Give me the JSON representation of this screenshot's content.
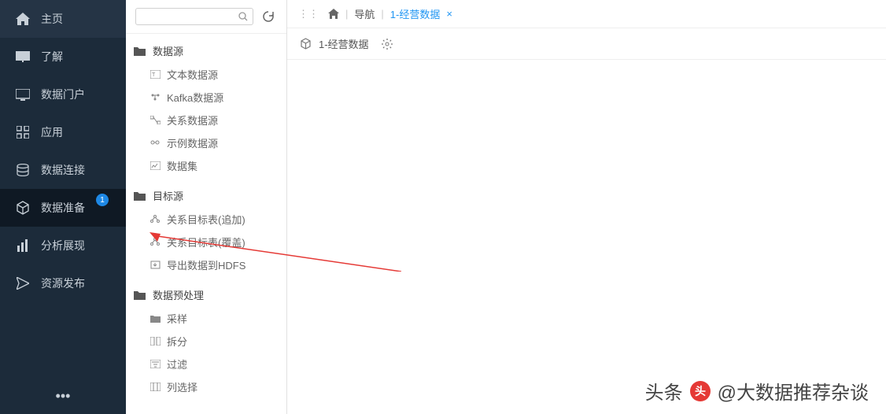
{
  "sidebar": {
    "items": [
      {
        "label": "主页",
        "icon": "home"
      },
      {
        "label": "了解",
        "icon": "book"
      },
      {
        "label": "数据门户",
        "icon": "monitor"
      },
      {
        "label": "应用",
        "icon": "apps"
      },
      {
        "label": "数据连接",
        "icon": "database"
      },
      {
        "label": "数据准备",
        "icon": "cube",
        "badge": "1",
        "active": true
      },
      {
        "label": "分析展现",
        "icon": "chart"
      },
      {
        "label": "资源发布",
        "icon": "send"
      }
    ],
    "more": "•••"
  },
  "search": {
    "placeholder": ""
  },
  "tree": {
    "folders": [
      {
        "label": "数据源",
        "items": [
          {
            "label": "文本数据源",
            "icon": "text"
          },
          {
            "label": "Kafka数据源",
            "icon": "kafka"
          },
          {
            "label": "关系数据源",
            "icon": "relation"
          },
          {
            "label": "示例数据源",
            "icon": "sample"
          },
          {
            "label": "数据集",
            "icon": "dataset"
          }
        ]
      },
      {
        "label": "目标源",
        "items": [
          {
            "label": "关系目标表(追加)",
            "icon": "node"
          },
          {
            "label": "关系目标表(覆盖)",
            "icon": "node",
            "highlight": true
          },
          {
            "label": "导出数据到HDFS",
            "icon": "export"
          }
        ]
      },
      {
        "label": "数据预处理",
        "items": [
          {
            "label": "采样",
            "icon": "folder-sm"
          },
          {
            "label": "拆分",
            "icon": "split"
          },
          {
            "label": "过滤",
            "icon": "filter"
          },
          {
            "label": "列选择",
            "icon": "columns"
          }
        ]
      }
    ]
  },
  "breadcrumb": {
    "nav_label": "导航",
    "tab_label": "1-经营数据"
  },
  "toolbar": {
    "title": "1-经营数据"
  },
  "watermark": {
    "prefix": "头条",
    "text": "@大数据推荐杂谈"
  }
}
